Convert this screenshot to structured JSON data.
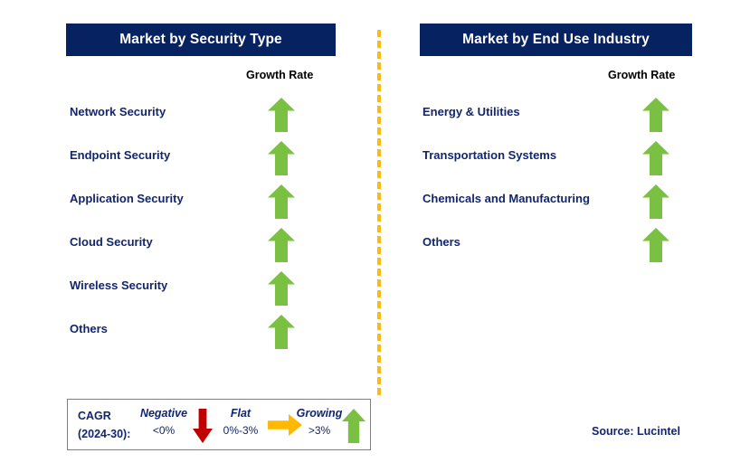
{
  "panels": [
    {
      "id": "security-type",
      "title": "Market by Security Type",
      "growth_rate_label": "Growth Rate",
      "rows": [
        {
          "label": "Network Security",
          "trend": "growing",
          "icon": "up-arrow-icon"
        },
        {
          "label": "Endpoint Security",
          "trend": "growing",
          "icon": "up-arrow-icon"
        },
        {
          "label": "Application Security",
          "trend": "growing",
          "icon": "up-arrow-icon"
        },
        {
          "label": "Cloud Security",
          "trend": "growing",
          "icon": "up-arrow-icon"
        },
        {
          "label": "Wireless Security",
          "trend": "growing",
          "icon": "up-arrow-icon"
        },
        {
          "label": "Others",
          "trend": "growing",
          "icon": "up-arrow-icon"
        }
      ]
    },
    {
      "id": "end-use-industry",
      "title": "Market by End Use Industry",
      "growth_rate_label": "Growth Rate",
      "rows": [
        {
          "label": "Energy & Utilities",
          "trend": "growing",
          "icon": "up-arrow-icon"
        },
        {
          "label": "Transportation Systems",
          "trend": "growing",
          "icon": "up-arrow-icon"
        },
        {
          "label": "Chemicals and Manufacturing",
          "trend": "growing",
          "icon": "up-arrow-icon"
        },
        {
          "label": "Others",
          "trend": "growing",
          "icon": "up-arrow-icon"
        }
      ]
    }
  ],
  "legend": {
    "cagr_line1": "CAGR",
    "cagr_line2": "(2024-30):",
    "items": [
      {
        "word": "Negative",
        "range": "<0%",
        "icon": "down-arrow-icon",
        "color": "#C00000"
      },
      {
        "word": "Flat",
        "range": "0%-3%",
        "icon": "right-arrow-icon",
        "color": "#FFB900"
      },
      {
        "word": "Growing",
        "range": ">3%",
        "icon": "up-arrow-icon",
        "color": "#7AC143"
      }
    ]
  },
  "source": "Source: Lucintel",
  "colors": {
    "title_bar": "#062260",
    "text_navy": "#11266E",
    "arrow_green": "#7AC143",
    "arrow_red": "#C00000",
    "arrow_amber": "#FFB900",
    "divider_amber": "#FDBB12",
    "legend_border": "#7F7F7F"
  }
}
